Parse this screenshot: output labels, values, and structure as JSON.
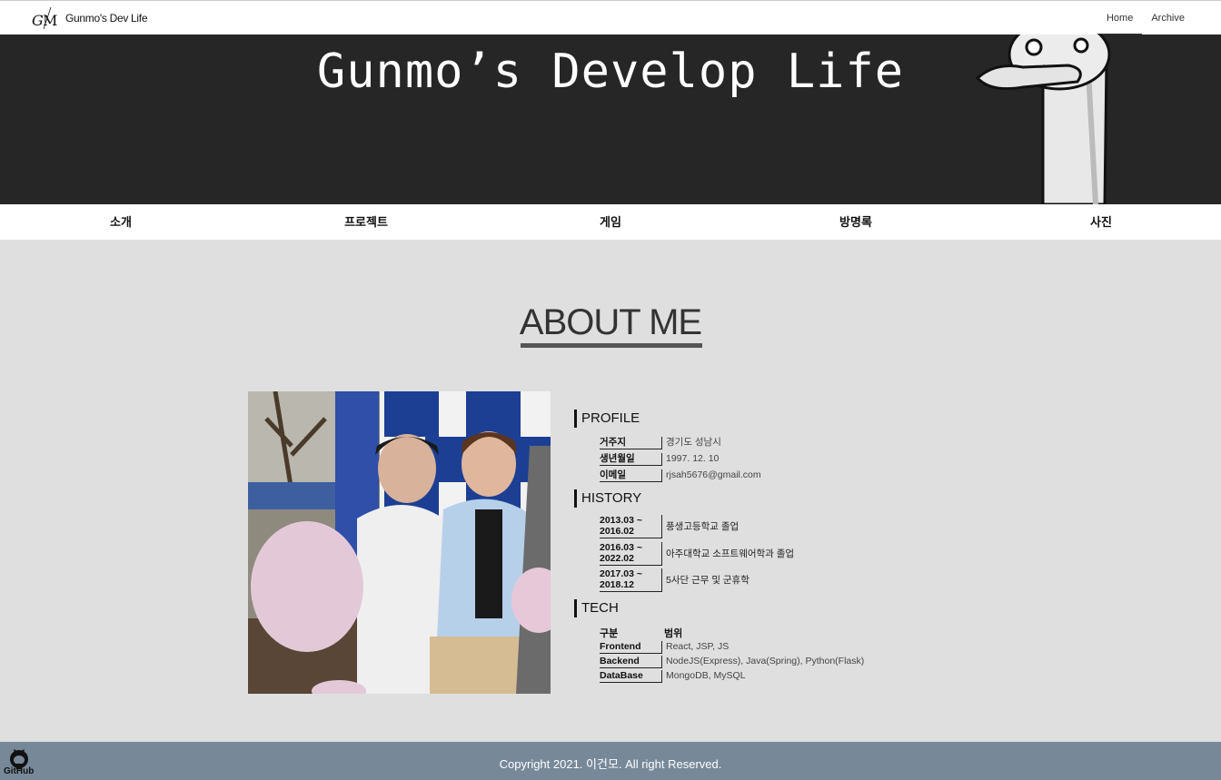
{
  "header": {
    "logo_text": "GM",
    "site_title": "Gunmo's Dev Life",
    "nav": [
      {
        "label": "Home",
        "active": true
      },
      {
        "label": "Archive",
        "active": false
      }
    ]
  },
  "hero": {
    "title": "Gunmo’s Develop Life"
  },
  "category_nav": [
    "소개",
    "프로젝트",
    "게임",
    "방명록",
    "사진"
  ],
  "about": {
    "title": "ABOUT ME",
    "profile": {
      "heading": "PROFILE",
      "rows": [
        {
          "label": "거주지",
          "value": "경기도 성남시"
        },
        {
          "label": "생년월일",
          "value": "1997. 12. 10"
        },
        {
          "label": "이메일",
          "value": "rjsah5676@gmail.com"
        }
      ]
    },
    "history": {
      "heading": "HISTORY",
      "rows": [
        {
          "period_start": "2013.03 ~",
          "period_end": "2016.02",
          "value": "풍생고등학교 졸업"
        },
        {
          "period_start": "2016.03 ~",
          "period_end": "2022.02",
          "value": "아주대학교 소프트웨어학과 졸업"
        },
        {
          "period_start": "2017.03 ~",
          "period_end": "2018.12",
          "value": "5사단 근무 및 군휴학"
        }
      ]
    },
    "tech": {
      "heading": "TECH",
      "col_category": "구분",
      "col_scope": "범위",
      "rows": [
        {
          "label": "Frontend",
          "value": "React, JSP, JS"
        },
        {
          "label": "Backend",
          "value": "NodeJS(Express), Java(Spring), Python(Flask)"
        },
        {
          "label": "DataBase",
          "value": "MongoDB, MySQL"
        }
      ]
    }
  },
  "footer": {
    "copyright": "Copyright 2021. 이건모. All right Reserved.",
    "github_label": "GitHub"
  },
  "colors": {
    "hero_bg": "#262626",
    "page_bg": "#dfdfdf",
    "footer_bg": "#778899"
  },
  "icons": [
    "gm-logo-icon",
    "github-icon",
    "mascot-illustration"
  ]
}
